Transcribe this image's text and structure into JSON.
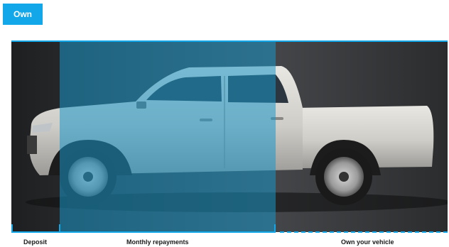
{
  "header": {
    "badge_label": "Own"
  },
  "timeline": {
    "segments": [
      {
        "label": "Deposit"
      },
      {
        "label": "Monthly repayments"
      },
      {
        "label": "Own your vehicle"
      }
    ]
  },
  "colors": {
    "accent": "#12a7e8",
    "overlay": "#1a96c6",
    "background_dark": "#2a2c2e"
  },
  "image": {
    "subject": "pickup-truck"
  }
}
